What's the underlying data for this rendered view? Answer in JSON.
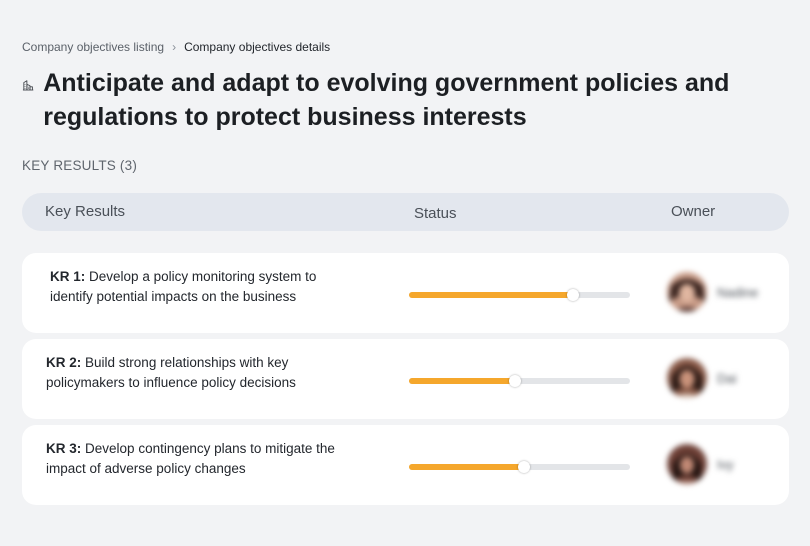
{
  "breadcrumb": {
    "parent": "Company objectives listing",
    "separator": "›",
    "current": "Company objectives details"
  },
  "page": {
    "title": "Anticipate and adapt to evolving government policies and regulations to protect business interests",
    "icon": "building-icon"
  },
  "key_results_label": "KEY RESULTS (3)",
  "table": {
    "headers": {
      "key_results": "Key Results",
      "status": "Status",
      "owner": "Owner"
    }
  },
  "key_results": [
    {
      "code": "KR 1:",
      "text": "Develop a policy monitoring system to identify potential impacts on the business",
      "progress": 0.74,
      "owner": "Nadine"
    },
    {
      "code": "KR 2:",
      "text": "Build strong relationships with key policymakers to influence policy decisions",
      "progress": 0.48,
      "owner": "Dai"
    },
    {
      "code": "KR 3:",
      "text": "Develop contingency plans to mitigate the impact of adverse policy changes",
      "progress": 0.52,
      "owner": "Ivy"
    }
  ],
  "colors": {
    "progress_fill": "#f5a72c",
    "progress_track": "#e3e5e8",
    "header_bg": "#e3e7ee",
    "page_bg": "#f2f3f5"
  }
}
